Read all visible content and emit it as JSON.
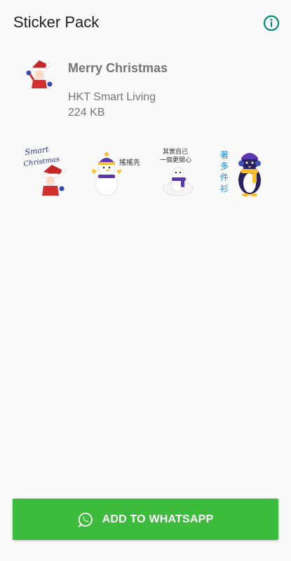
{
  "app_bar": {
    "title": "Sticker Pack",
    "info_icon": "info-icon"
  },
  "pack": {
    "name": "Merry Christmas",
    "publisher": "HKT Smart Living",
    "size": "224 KB",
    "tray_icon": "santa-icon"
  },
  "stickers": [
    {
      "icon": "santa-sticker",
      "caption": "Smart Christmas"
    },
    {
      "icon": "snowman-bell-sticker",
      "caption": "搖搖先"
    },
    {
      "icon": "snowman-scarf-sticker",
      "caption": "其實自己一個更開心"
    },
    {
      "icon": "penguin-sticker",
      "caption": "著多件衫"
    }
  ],
  "footer": {
    "add_button_label": "ADD TO WHATSAPP",
    "whatsapp_icon": "whatsapp-icon"
  },
  "colors": {
    "accent_teal": "#00897b",
    "button_green": "#3dbb3d",
    "text_primary": "#212121",
    "text_secondary": "#757575"
  }
}
